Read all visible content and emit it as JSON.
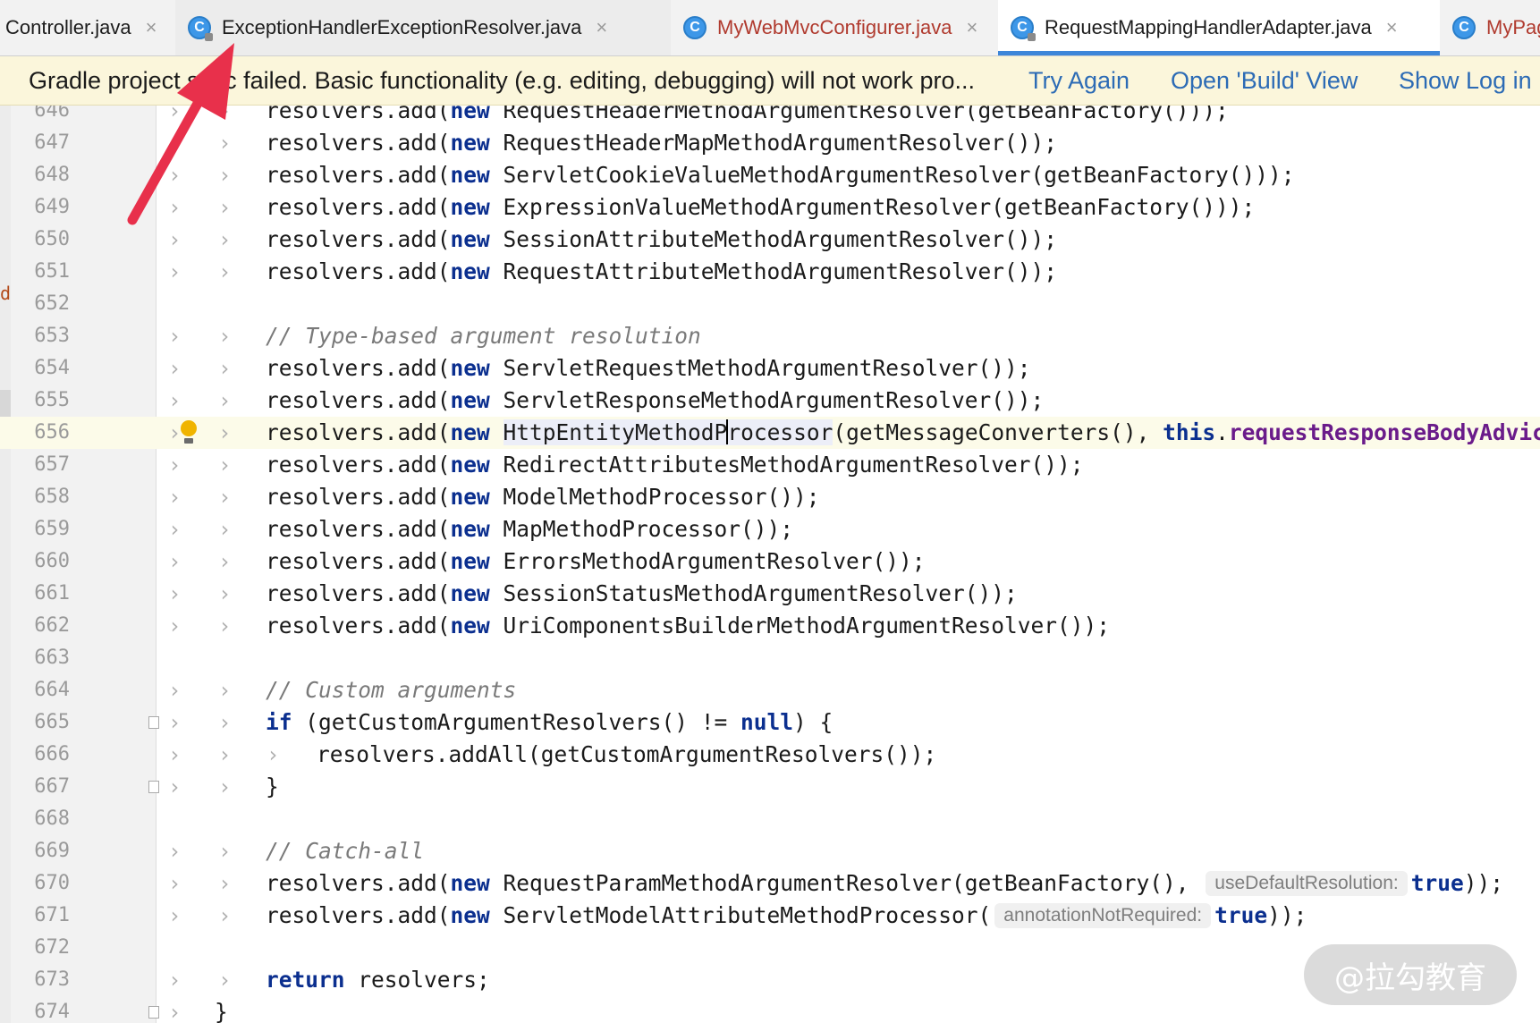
{
  "tabs": [
    {
      "label": "Controller.java",
      "icon": "class-icon",
      "active": false
    },
    {
      "label": "ExceptionHandlerExceptionResolver.java",
      "icon": "class-icon",
      "active": false
    },
    {
      "label": "MyWebMvcConfigurer.java",
      "icon": "class-icon",
      "active": false
    },
    {
      "label": "RequestMappingHandlerAdapter.java",
      "icon": "class-icon",
      "active": true
    },
    {
      "label": "MyPage",
      "icon": "class-icon",
      "active": false
    }
  ],
  "tab_close_glyph": "×",
  "class_icon_letter": "C",
  "notification": {
    "message": "Gradle project sync failed. Basic functionality (e.g. editing, debugging) will not work pro...",
    "actions": [
      "Try Again",
      "Open 'Build' View",
      "Show Log in"
    ]
  },
  "gutter_marker": "d.",
  "lines": [
    {
      "num": "646",
      "code": "resolvers.add(new RequestHeaderMethodArgumentResolver(getBeanFactory()));"
    },
    {
      "num": "647",
      "code": "resolvers.add(new RequestHeaderMapMethodArgumentResolver());"
    },
    {
      "num": "648",
      "code": "resolvers.add(new ServletCookieValueMethodArgumentResolver(getBeanFactory()));"
    },
    {
      "num": "649",
      "code": "resolvers.add(new ExpressionValueMethodArgumentResolver(getBeanFactory()));"
    },
    {
      "num": "650",
      "code": "resolvers.add(new SessionAttributeMethodArgumentResolver());"
    },
    {
      "num": "651",
      "code": "resolvers.add(new RequestAttributeMethodArgumentResolver());"
    },
    {
      "num": "652",
      "code": ""
    },
    {
      "num": "653",
      "code": "// Type-based argument resolution"
    },
    {
      "num": "654",
      "code": "resolvers.add(new ServletRequestMethodArgumentResolver());"
    },
    {
      "num": "655",
      "code": "resolvers.add(new ServletResponseMethodArgumentResolver());"
    },
    {
      "num": "656",
      "code": "resolvers.add(new HttpEntityMethodProcessor(getMessageConverters(), this.requestResponseBodyAdvice));"
    },
    {
      "num": "657",
      "code": "resolvers.add(new RedirectAttributesMethodArgumentResolver());"
    },
    {
      "num": "658",
      "code": "resolvers.add(new ModelMethodProcessor());"
    },
    {
      "num": "659",
      "code": "resolvers.add(new MapMethodProcessor());"
    },
    {
      "num": "660",
      "code": "resolvers.add(new ErrorsMethodArgumentResolver());"
    },
    {
      "num": "661",
      "code": "resolvers.add(new SessionStatusMethodArgumentResolver());"
    },
    {
      "num": "662",
      "code": "resolvers.add(new UriComponentsBuilderMethodArgumentResolver());"
    },
    {
      "num": "663",
      "code": ""
    },
    {
      "num": "664",
      "code": "// Custom arguments"
    },
    {
      "num": "665",
      "code": "if (getCustomArgumentResolvers() != null) {"
    },
    {
      "num": "666",
      "code": "resolvers.addAll(getCustomArgumentResolvers());"
    },
    {
      "num": "667",
      "code": "}"
    },
    {
      "num": "668",
      "code": ""
    },
    {
      "num": "669",
      "code": "// Catch-all"
    },
    {
      "num": "670",
      "code": "resolvers.add(new RequestParamMethodArgumentResolver(getBeanFactory(), useDefaultResolution: true));"
    },
    {
      "num": "671",
      "code": "resolvers.add(new ServletModelAttributeMethodProcessor( annotationNotRequired: true));"
    },
    {
      "num": "672",
      "code": ""
    },
    {
      "num": "673",
      "code": "return resolvers;"
    },
    {
      "num": "674",
      "code": "}"
    }
  ],
  "code_parts": {
    "l646": {
      "pre": "resolvers.add(",
      "kw": "new",
      "post": " RequestHeaderMethodArgumentResolver(getBeanFactory()));"
    },
    "l647": {
      "pre": "resolvers.add(",
      "kw": "new",
      "post": " RequestHeaderMapMethodArgumentResolver());"
    },
    "l648": {
      "pre": "resolvers.add(",
      "kw": "new",
      "post": " ServletCookieValueMethodArgumentResolver(getBeanFactory()));"
    },
    "l649": {
      "pre": "resolvers.add(",
      "kw": "new",
      "post": " ExpressionValueMethodArgumentResolver(getBeanFactory()));"
    },
    "l650": {
      "pre": "resolvers.add(",
      "kw": "new",
      "post": " SessionAttributeMethodArgumentResolver());"
    },
    "l651": {
      "pre": "resolvers.add(",
      "kw": "new",
      "post": " RequestAttributeMethodArgumentResolver());"
    },
    "l653": {
      "comment": "// Type-based argument resolution"
    },
    "l654": {
      "pre": "resolvers.add(",
      "kw": "new",
      "post": " ServletRequestMethodArgumentResolver());"
    },
    "l655": {
      "pre": "resolvers.add(",
      "kw": "new",
      "post": " ServletResponseMethodArgumentResolver());"
    },
    "l656": {
      "pre": "resolvers.add(",
      "kw": "new",
      "word_a": "HttpEntityMethodP",
      "word_b": "rocessor",
      "mid": "(getMessageConverters(), ",
      "kw2": "this",
      "dot": ".",
      "field": "requestResponseBodyAdvice",
      "end": "));"
    },
    "l657": {
      "pre": "resolvers.add(",
      "kw": "new",
      "post": " RedirectAttributesMethodArgumentResolver());"
    },
    "l658": {
      "pre": "resolvers.add(",
      "kw": "new",
      "post": " ModelMethodProcessor());"
    },
    "l659": {
      "pre": "resolvers.add(",
      "kw": "new",
      "post": " MapMethodProcessor());"
    },
    "l660": {
      "pre": "resolvers.add(",
      "kw": "new",
      "post": " ErrorsMethodArgumentResolver());"
    },
    "l661": {
      "pre": "resolvers.add(",
      "kw": "new",
      "post": " SessionStatusMethodArgumentResolver());"
    },
    "l662": {
      "pre": "resolvers.add(",
      "kw": "new",
      "post": " UriComponentsBuilderMethodArgumentResolver());"
    },
    "l664": {
      "comment": "// Custom arguments"
    },
    "l665": {
      "kw": "if",
      "mid": " (getCustomArgumentResolvers() != ",
      "kw2": "null",
      "end": ") {"
    },
    "l666": {
      "text": "resolvers.addAll(getCustomArgumentResolvers());"
    },
    "l667": {
      "text": "}"
    },
    "l669": {
      "comment": "// Catch-all"
    },
    "l670": {
      "pre": "resolvers.add(",
      "kw": "new",
      "post": " RequestParamMethodArgumentResolver(getBeanFactory(), ",
      "hint": "useDefaultResolution:",
      "kw2": "true",
      "end": "));"
    },
    "l671": {
      "pre": "resolvers.add(",
      "kw": "new",
      "post": " ServletModelAttributeMethodProcessor(",
      "hint": "annotationNotRequired:",
      "kw2": "true",
      "end": "));"
    },
    "l673": {
      "kw": "return",
      "post": " resolvers;"
    },
    "l674": {
      "text": "}"
    }
  },
  "gutter_glyph": "›",
  "watermark": "@拉勾教育",
  "colors": {
    "keyword": "#0b2f8f",
    "comment": "#7a7a7a",
    "field": "#6a1b8a",
    "link": "#2c6bb5",
    "notice_bg": "#fbf6db",
    "annotation_arrow": "#e8304b",
    "active_tab_underline": "#3d86d9"
  }
}
